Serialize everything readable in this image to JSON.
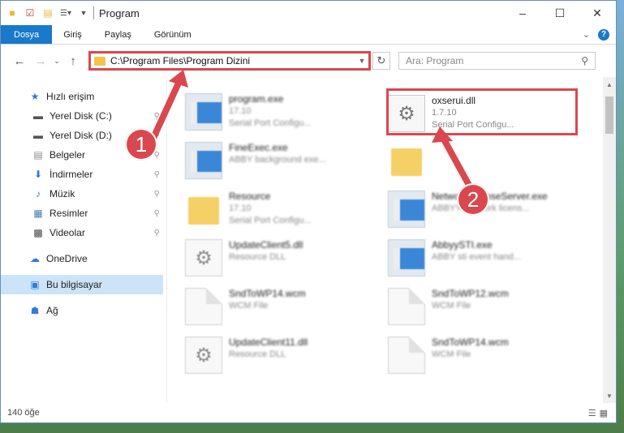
{
  "window": {
    "title": "Program",
    "status_count": "140 öğe"
  },
  "ribbon": {
    "tabs": [
      "Dosya",
      "Giriş",
      "Paylaş",
      "Görünüm"
    ]
  },
  "address": {
    "path": "C:\\Program Files\\Program Dizini"
  },
  "search": {
    "placeholder": "Ara: Program"
  },
  "sidebar": {
    "quick_access": "Hızlı erişim",
    "items": [
      {
        "label": "Yerel Disk (C:)"
      },
      {
        "label": "Yerel Disk (D:)"
      },
      {
        "label": "Belgeler"
      },
      {
        "label": "İndirmeler"
      },
      {
        "label": "Müzik"
      },
      {
        "label": "Resimler"
      },
      {
        "label": "Videolar"
      }
    ],
    "onedrive": "OneDrive",
    "this_pc": "Bu bilgisayar",
    "network": "Ağ"
  },
  "files": [
    {
      "name": "program.exe",
      "version": "17.10",
      "desc": "Serial Port Configu..."
    },
    {
      "name": "oxserui.dll",
      "version": "1.7.10",
      "desc": "Serial Port Configu..."
    },
    {
      "name": "FineExec.exe",
      "version": "",
      "desc": "ABBY background exe..."
    },
    {
      "name": "Resource",
      "version": "17.10",
      "desc": "Serial Port Configu..."
    },
    {
      "name": "NetworkLicenseServer.exe",
      "version": "",
      "desc": "ABBYY Network licens..."
    },
    {
      "name": "UpdateClient5.dll",
      "version": "",
      "desc": "Resource DLL"
    },
    {
      "name": "AbbyySTI.exe",
      "version": "",
      "desc": "ABBY sti event hand..."
    },
    {
      "name": "SndToWP14.wcm",
      "version": "",
      "desc": "WCM File"
    },
    {
      "name": "SndToWP12.wcm",
      "version": "",
      "desc": "WCM File"
    },
    {
      "name": "UpdateClient11.dll",
      "version": "",
      "desc": "Resource DLL"
    },
    {
      "name": "SndToWP14.wcm",
      "version": "",
      "desc": "WCM File"
    }
  ],
  "annotations": {
    "marker1": "1",
    "marker2": "2",
    "accent": "#d9484e"
  }
}
